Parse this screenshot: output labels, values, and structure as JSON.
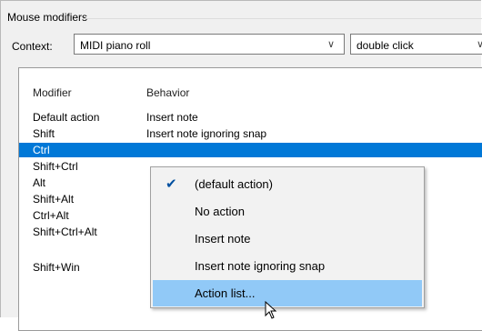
{
  "group": {
    "title": "Mouse modifiers"
  },
  "context": {
    "label": "Context:",
    "value": "MIDI piano roll",
    "click_value": "double click"
  },
  "table": {
    "headers": [
      "Modifier",
      "Behavior"
    ],
    "rows": [
      {
        "modifier": "Default action",
        "behavior": "Insert note"
      },
      {
        "modifier": "Shift",
        "behavior": "Insert note ignoring snap"
      },
      {
        "modifier": "Ctrl",
        "behavior": "",
        "selected": true
      },
      {
        "modifier": "Shift+Ctrl",
        "behavior": ""
      },
      {
        "modifier": "Alt",
        "behavior": ""
      },
      {
        "modifier": "Shift+Alt",
        "behavior": ""
      },
      {
        "modifier": "Ctrl+Alt",
        "behavior": ""
      },
      {
        "modifier": "Shift+Ctrl+Alt",
        "behavior": ""
      },
      {
        "modifier": "Shift+Win",
        "behavior": ""
      }
    ]
  },
  "menu": {
    "items": [
      {
        "label": "(default action)",
        "checked": true
      },
      {
        "label": "No action"
      },
      {
        "label": "Insert note"
      },
      {
        "label": "Insert note ignoring snap"
      },
      {
        "label": "Action list...",
        "highlighted": true
      }
    ]
  },
  "colors": {
    "selection": "#0078d7",
    "menu_highlight": "#91c9f7"
  }
}
